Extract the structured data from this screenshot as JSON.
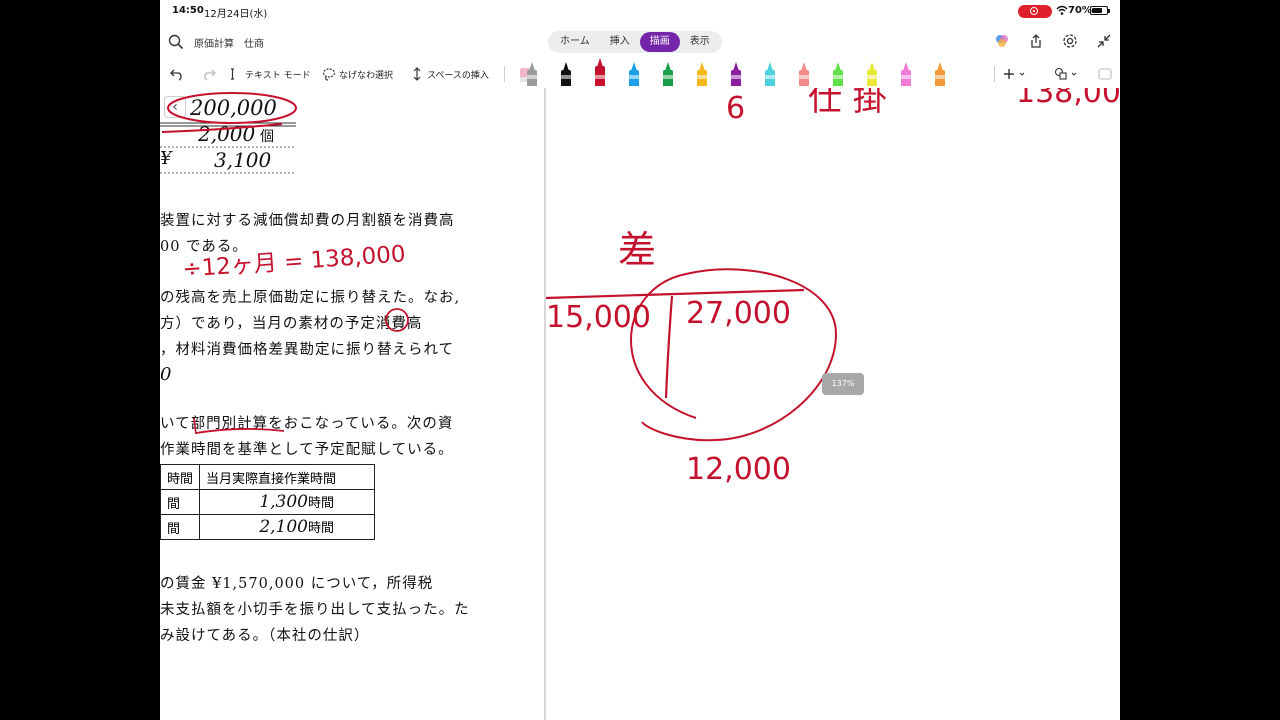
{
  "status": {
    "time": "14:50",
    "date": "12月24日(水)",
    "battery": "70%",
    "battery_level": 0.7
  },
  "header": {
    "title": "原価計算　仕商",
    "tabs": [
      {
        "label": "ホーム",
        "active": false
      },
      {
        "label": "挿入",
        "active": false
      },
      {
        "label": "描画",
        "active": true
      },
      {
        "label": "表示",
        "active": false
      }
    ]
  },
  "toolbar": {
    "text_mode": "テキスト モード",
    "lasso": "なげなわ選択",
    "insert_space": "スペースの挿入",
    "pen_colors": [
      "#9b9b9b",
      "#111111",
      "#c4122e",
      "#1aa0e6",
      "#1a9e4a",
      "#f2b81c",
      "#8a1fa0",
      "#4fd0e0",
      "#f28a8a",
      "#62e04a",
      "#e8e83a",
      "#f07ad8",
      "#f29a3a"
    ]
  },
  "left_page": {
    "values": {
      "v1": "200,000",
      "v2": "2,000",
      "v2_unit": "個",
      "v3_prefix": "¥",
      "v3": "3,100"
    },
    "paragraphs": [
      "装置に対する減価償却費の月割額を消費高",
      "00 である。",
      "の残高を売上原価勘定に振り替えた。なお,",
      "方）であり，当月の素材の予定消費高",
      "，材料消費価格差異勘定に振り替えられて",
      "0",
      "いて部門別計算をおこなっている。次の資",
      "作業時間を基準として予定配賦している。",
      "の賃金 ¥1,570,000 について，所得税",
      "未支払額を小切手を振り出して支払った。た",
      "み設けてある。（本社の仕訳）"
    ],
    "table": {
      "header": [
        "時間",
        "当月実際直接作業時間"
      ],
      "rows": [
        [
          "間",
          "1,300",
          "時間"
        ],
        [
          "間",
          "2,100",
          "時間"
        ]
      ]
    },
    "red_note": "÷12ヶ月 = 138,000"
  },
  "right_page": {
    "top_note_left": "6",
    "top_note_mid": "仕 掛",
    "top_note_right": "138,00",
    "label_sa": "差",
    "left_value": "15,000",
    "right_value": "27,000",
    "bottom_value": "12,000",
    "zoom": "137%"
  }
}
